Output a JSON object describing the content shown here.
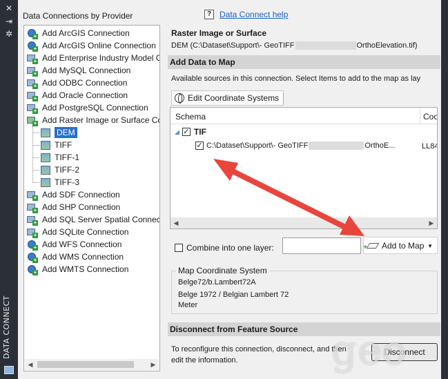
{
  "sidebar": {
    "vertical_label": "DATA CONNECT",
    "icons": [
      "close-icon",
      "pin-icon",
      "settings-icon"
    ]
  },
  "providers": {
    "heading": "Data Connections by Provider",
    "items": [
      {
        "label": "Add ArcGIS Connection",
        "icon": "globe-plus-icon"
      },
      {
        "label": "Add ArcGIS Online Connection",
        "icon": "globe-plus-icon"
      },
      {
        "label": "Add Enterprise Industry Model C",
        "icon": "db-plus-icon"
      },
      {
        "label": "Add MySQL Connection",
        "icon": "db-plus-icon"
      },
      {
        "label": "Add ODBC Connection",
        "icon": "db-plus-icon"
      },
      {
        "label": "Add Oracle Connection",
        "icon": "db-plus-icon"
      },
      {
        "label": "Add PostgreSQL Connection",
        "icon": "db-plus-icon"
      },
      {
        "label": "Add Raster Image or Surface Co",
        "icon": "raster-plus-icon"
      }
    ],
    "raster_children": [
      "DEM",
      "TIFF",
      "TIFF-1",
      "TIFF-2",
      "TIFF-3"
    ],
    "items_after": [
      {
        "label": "Add SDF Connection",
        "icon": "db-plus-icon"
      },
      {
        "label": "Add SHP Connection",
        "icon": "db-plus-icon"
      },
      {
        "label": "Add SQL Server Spatial Connect",
        "icon": "db-plus-icon"
      },
      {
        "label": "Add SQLite Connection",
        "icon": "db-plus-icon"
      },
      {
        "label": "Add WFS Connection",
        "icon": "globe-plus-icon"
      },
      {
        "label": "Add WMS Connection",
        "icon": "globe-plus-icon"
      },
      {
        "label": "Add WMTS Connection",
        "icon": "globe-plus-icon"
      }
    ]
  },
  "help": {
    "icon_text": "?",
    "link": "Data Connect help"
  },
  "source": {
    "title": "Raster Image or Surface",
    "path_start": "DEM (C:\\Dataset\\Support\\- GeoTIFF",
    "path_end": "OrthoElevation.tif)"
  },
  "add_data": {
    "heading": "Add Data to Map",
    "available": "Available sources in this connection.  Select Items to add to the map as lay",
    "edit_cs": "Edit Coordinate Systems",
    "col_schema": "Schema",
    "col_coord": "Coo",
    "group": "TIF",
    "item_start": "C:\\Dataset\\Support\\- GeoTIFF",
    "item_end": "OrthoE...",
    "item_cs": "LL84",
    "combine_label": "Combine into one layer:",
    "add_to_map": "Add to Map"
  },
  "map_cs": {
    "legend": "Map Coordinate System",
    "line1": "Belge72/b.Lambert72A",
    "line2": "Belge 1972 / Belgian Lambert 72",
    "line3": "Meter"
  },
  "disconnect": {
    "heading": "Disconnect from Feature Source",
    "text": "To reconfigure this connection, disconnect, and then edit the information.",
    "button": "Disconnect"
  },
  "watermark": "geo",
  "colors": {
    "selection": "#2a6fc9",
    "arrow": "#e8453c",
    "link": "#1f5fbf"
  }
}
